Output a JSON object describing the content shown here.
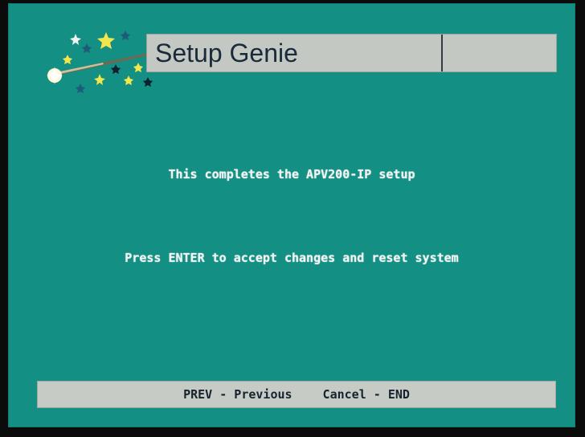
{
  "header": {
    "title": "Setup Genie",
    "logo_icon": "magic-wand-stars-icon"
  },
  "main": {
    "line1": "This completes the APV200-IP setup",
    "line2": "Press ENTER to accept changes and reset system"
  },
  "footer": {
    "prev_label": "PREV - Previous",
    "cancel_label": "Cancel - END"
  },
  "colors": {
    "background": "#138f84",
    "bar": "#c4c8c2",
    "text_light": "#f0f3f0",
    "text_dark": "#17232e"
  }
}
